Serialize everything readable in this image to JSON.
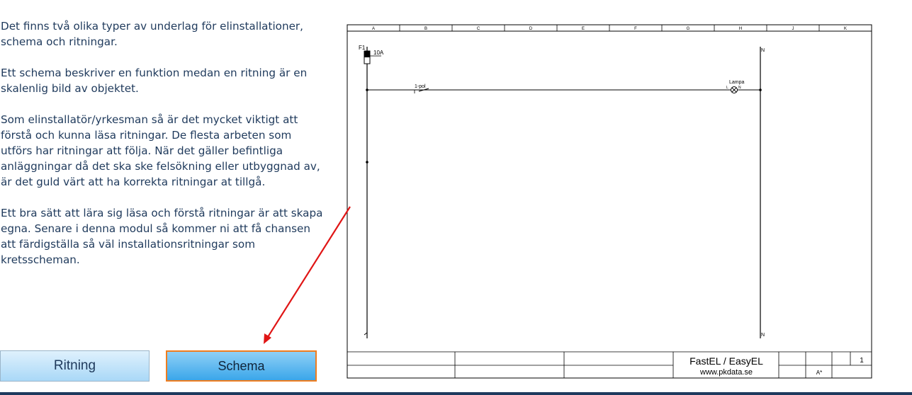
{
  "text": {
    "p1": "Det finns två olika typer av underlag för elinstallationer, schema och ritningar.",
    "p2": "Ett schema beskriver en funktion medan en ritning är en skalenlig bild av objektet.",
    "p3": "Som elinstallatör/yrkesman så är det mycket viktigt att förstå och kunna läsa ritningar. De flesta arbeten som utförs har ritningar att följa. När det gäller befintliga anläggningar då det ska ske felsökning eller utbyggnad av, är det guld värt att ha korrekta ritningar at tillgå.",
    "p4": "Ett bra sätt att lära sig läsa och förstå ritningar är att skapa egna. Senare i denna modul så kommer ni att få chansen att färdigställa så väl installationsritningar som kretsscheman."
  },
  "buttons": {
    "ritning": "Ritning",
    "schema": "Schema"
  },
  "schematic": {
    "columns": [
      "A",
      "B",
      "C",
      "D",
      "E",
      "F",
      "G",
      "H",
      "J",
      "K"
    ],
    "fuse_label": "F1",
    "fuse_rating": "10A",
    "switch_label": "1-pol",
    "lamp_label": "Lampa",
    "l_mark": "L",
    "n_mark": "N",
    "title_block": {
      "company": "FastEL / EasyEL",
      "website": "www.pkdata.se",
      "sheet_number": "1",
      "revision": "A*"
    }
  },
  "colors": {
    "text": "#1f3a5c",
    "arrow": "#e01515",
    "accent_border": "#f07d1e"
  }
}
